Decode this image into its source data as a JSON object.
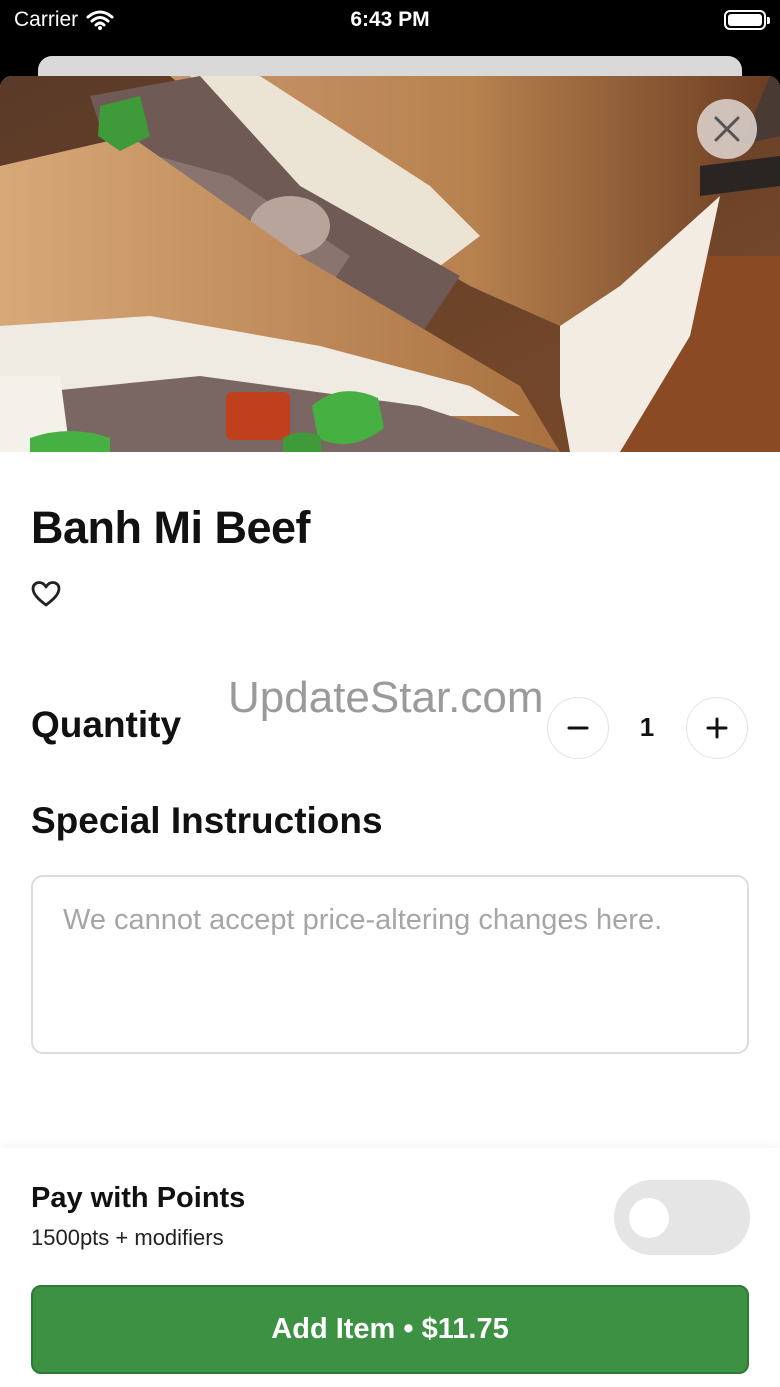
{
  "status_bar": {
    "carrier": "Carrier",
    "time": "6:43 PM"
  },
  "item": {
    "name": "Banh Mi Beef"
  },
  "watermark": "UpdateStar.com",
  "quantity": {
    "label": "Quantity",
    "value": "1"
  },
  "special_instructions": {
    "label": "Special Instructions",
    "placeholder": "We cannot accept price-altering changes here."
  },
  "pay_with_points": {
    "title": "Pay with Points",
    "subtitle": "1500pts + modifiers",
    "enabled": false
  },
  "add_button": {
    "label": "Add Item • $11.75"
  },
  "icons": {
    "wifi": "wifi-icon",
    "battery": "battery-icon",
    "close": "close-icon",
    "favorite": "heart-icon",
    "minus": "minus-icon",
    "plus": "plus-icon"
  },
  "colors": {
    "accent_green": "#3d9142",
    "toggle_off": "#e5e5e5"
  }
}
